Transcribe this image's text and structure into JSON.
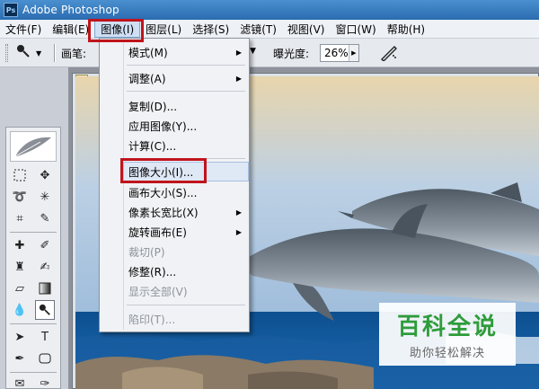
{
  "window": {
    "title": "Adobe Photoshop",
    "logo_text": "Ps"
  },
  "menubar": {
    "items": [
      {
        "label": "文件(F)"
      },
      {
        "label": "编辑(E)"
      },
      {
        "label": "图像(I)"
      },
      {
        "label": "图层(L)"
      },
      {
        "label": "选择(S)"
      },
      {
        "label": "滤镜(T)"
      },
      {
        "label": "视图(V)"
      },
      {
        "label": "窗口(W)"
      },
      {
        "label": "帮助(H)"
      }
    ],
    "active_index": 2
  },
  "options": {
    "brush_label": "画笔:",
    "exposure_label": "曝光度:",
    "exposure_value": "26%"
  },
  "image_menu": {
    "items": [
      {
        "label": "模式(M)",
        "submenu": true,
        "disabled": false
      },
      {
        "label": "调整(A)",
        "submenu": true,
        "disabled": false
      },
      {
        "label": "复制(D)...",
        "submenu": false,
        "disabled": false
      },
      {
        "label": "应用图像(Y)...",
        "submenu": false,
        "disabled": false
      },
      {
        "label": "计算(C)...",
        "submenu": false,
        "disabled": false
      },
      {
        "label": "图像大小(I)...",
        "submenu": false,
        "disabled": false,
        "highlighted": true
      },
      {
        "label": "画布大小(S)...",
        "submenu": false,
        "disabled": false
      },
      {
        "label": "像素长宽比(X)",
        "submenu": true,
        "disabled": false
      },
      {
        "label": "旋转画布(E)",
        "submenu": true,
        "disabled": false
      },
      {
        "label": "裁切(P)",
        "submenu": false,
        "disabled": true
      },
      {
        "label": "修整(R)...",
        "submenu": false,
        "disabled": false
      },
      {
        "label": "显示全部(V)",
        "submenu": false,
        "disabled": true
      },
      {
        "label": "陷印(T)...",
        "submenu": false,
        "disabled": true
      }
    ]
  },
  "watermark": {
    "title": "百科全说",
    "subtitle": "助你轻松解决"
  },
  "colors": {
    "highlight_box": "#c0141c",
    "title_bar": "#2b6cb0",
    "watermark_green": "#2e9c3b"
  }
}
